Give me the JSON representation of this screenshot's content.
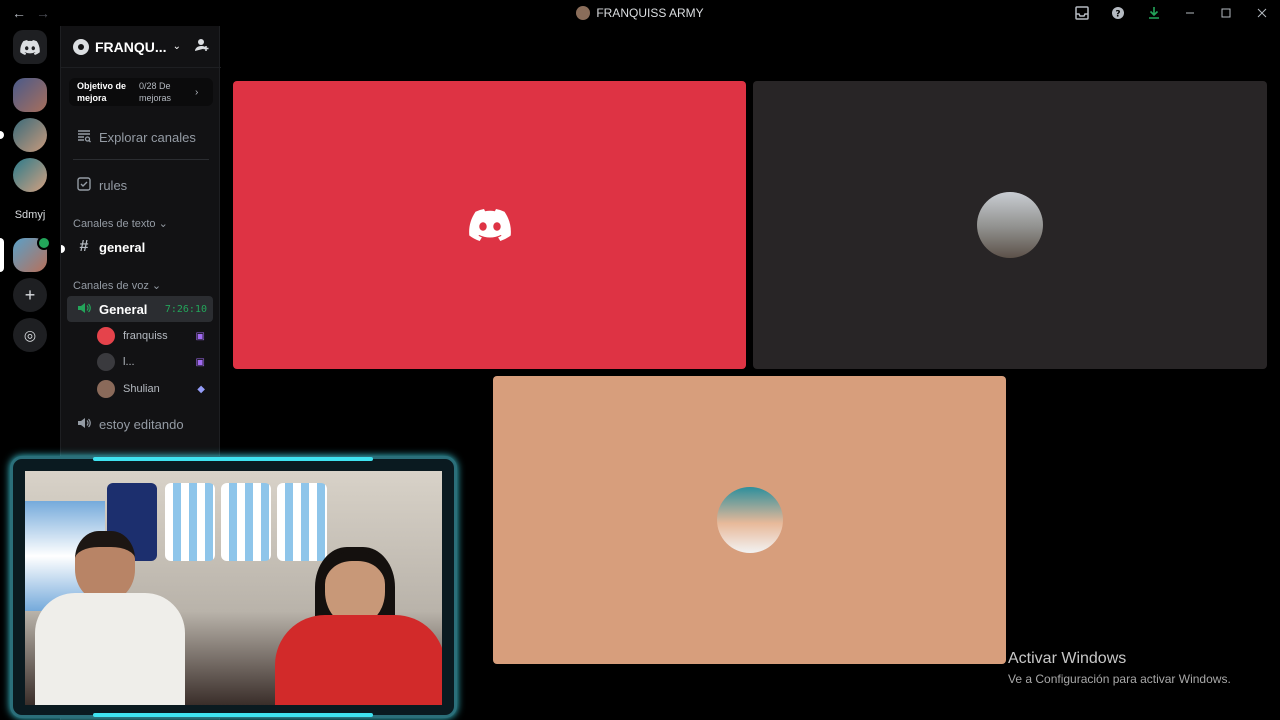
{
  "titlebar": {
    "back": "←",
    "forward": "→",
    "title": "FRANQUISS ARMY",
    "buttons": [
      "inbox-icon",
      "help-icon",
      "download-icon",
      "minimize-icon",
      "maximize-icon",
      "close-icon"
    ]
  },
  "rail": {
    "labeled_server": "Sdmyj",
    "add": "+",
    "explore": "◎"
  },
  "sidebar": {
    "server_name": "FRANQU...",
    "chevron": "⌄",
    "boost": {
      "goal_label": "Objetivo de mejora",
      "count": "0/28 De mejoras",
      "arrow": "›"
    },
    "explore_label": "Explorar canales",
    "rules_label": "rules",
    "text_category": "Canales de texto",
    "general_text": "general",
    "voice_category": "Canales de voz",
    "voice_channel": {
      "name": "General",
      "timer": "7:26:10"
    },
    "members": [
      {
        "name": "franquiss"
      },
      {
        "name": "l..."
      },
      {
        "name": "Shulian"
      }
    ],
    "editing_channel": "estoy editando"
  },
  "watermark": {
    "title": "Activar Windows",
    "subtitle": "Ve a Configuración para activar Windows."
  },
  "colors": {
    "tile_red": "#de3344",
    "tile_dark": "#282526",
    "tile_peach": "#d79e7c",
    "voice_green": "#23a55a",
    "cam_glow": "#3fe3f0"
  }
}
